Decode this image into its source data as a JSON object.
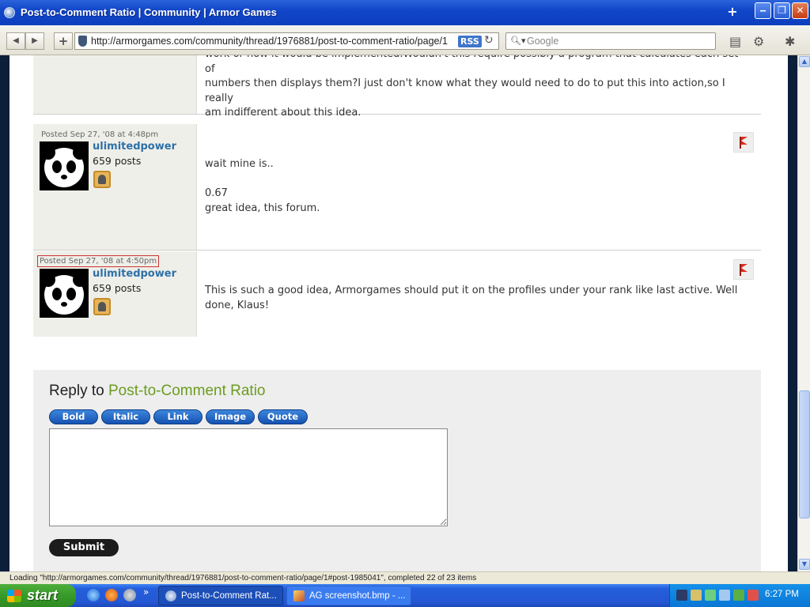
{
  "window": {
    "title": "Post-to-Comment Ratio | Community | Armor Games",
    "new_tab": "+",
    "minimize": "‒",
    "maximize": "❐",
    "close": "✕"
  },
  "nav": {
    "back": "◀",
    "forward": "▶",
    "add": "+",
    "url": "http://armorgames.com/community/thread/1976881/post-to-comment-ratio/page/1",
    "rss": "RSS",
    "reload": "↻",
    "search_placeholder": "Google",
    "page_menu": "▤",
    "tools_menu": "⚙",
    "debug": "✱"
  },
  "posts": [
    {
      "body_lines": [
        "work or how it would be implemented.Wouldn't this require possibly a program that calculates each set of",
        "numbers then displays them?I just don't know what they would need to do to put this into action,so I really",
        "am indifferent about this idea."
      ]
    },
    {
      "posted": "Posted Sep 27, '08 at 4:48pm",
      "username": "ulimitedpower",
      "post_count": "659 posts",
      "body_lines": [
        "wait mine is..",
        "",
        "0.67",
        "great idea, this forum."
      ]
    },
    {
      "posted": "Posted Sep 27, '08 at 4:50pm",
      "username": "ulimitedpower",
      "post_count": "659 posts",
      "body_lines": [
        "This is such a good idea, Armorgames should put it on the profiles under your rank like last active. Well",
        "done, Klaus!"
      ]
    }
  ],
  "reply": {
    "prefix": "Reply to",
    "thread_title": "Post-to-Comment Ratio",
    "format_buttons": [
      "Bold",
      "Italic",
      "Link",
      "Image",
      "Quote"
    ],
    "submit": "Submit"
  },
  "status": "Loading \"http://armorgames.com/community/thread/1976881/post-to-comment-ratio/page/1#post-1985041\", completed 22 of 23 items",
  "taskbar": {
    "start": "start",
    "more": "»",
    "tasks": [
      "Post-to-Comment Rat...",
      "AG screenshot.bmp - ..."
    ],
    "clock": "6:27 PM"
  }
}
